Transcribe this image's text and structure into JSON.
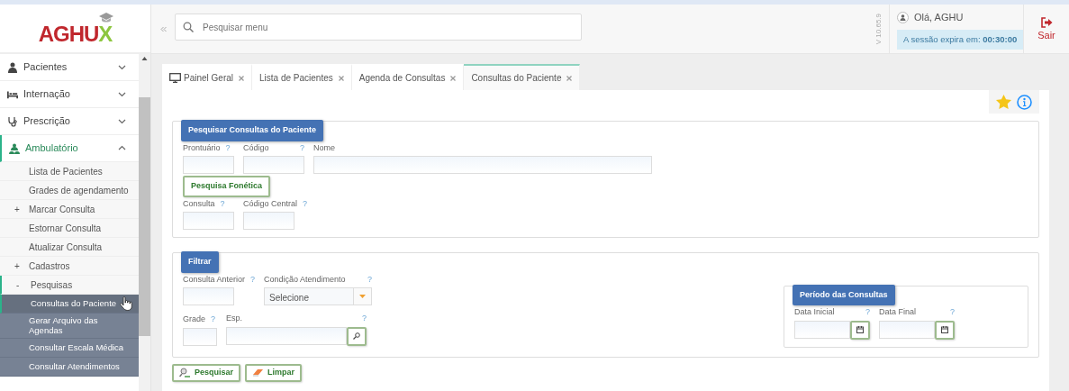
{
  "logo": {
    "main": "AGHU",
    "accent": "X"
  },
  "search": {
    "placeholder": "Pesquisar menu"
  },
  "version": "V 10.65.9",
  "user": {
    "greeting": "Olá, AGHU",
    "session": "A sessão expira em: **00:30:00**"
  },
  "logout": {
    "label": "Sair"
  },
  "sidebar": {
    "items": [
      {
        "label": "Pacientes",
        "expanded": false
      },
      {
        "label": "Internação",
        "expanded": false
      },
      {
        "label": "Prescrição",
        "expanded": false
      },
      {
        "label": "Ambulatório",
        "expanded": true,
        "children": [
          {
            "label": "Lista de Pacientes",
            "selected": false
          },
          {
            "label": "Grades de agendamento",
            "selected": false
          },
          {
            "label": "Marcar Consulta",
            "toggle": "+",
            "selected": false
          },
          {
            "label": "Estornar Consulta",
            "selected": false
          },
          {
            "label": "Atualizar Consulta",
            "selected": false
          },
          {
            "label": "Cadastros",
            "toggle": "+",
            "selected": false
          },
          {
            "label": "Pesquisas",
            "toggle": "-",
            "selected": false,
            "children": [
              {
                "label": "Consultas do Paciente",
                "selected": true
              },
              {
                "label": "Gerar Arquivo das Agendas",
                "selected": false
              },
              {
                "label": "Consultar Escala Médica",
                "selected": false
              },
              {
                "label": "Consultar Atendimentos",
                "selected": false
              }
            ]
          }
        ]
      }
    ]
  },
  "tabs": [
    {
      "label": "Painel Geral",
      "selected": false
    },
    {
      "label": "Lista de Pacientes",
      "selected": false
    },
    {
      "label": "Agenda de Consultas",
      "selected": false
    },
    {
      "label": "Consultas do Paciente",
      "selected": true
    }
  ],
  "search_form": {
    "legend": "Pesquisar Consultas do Paciente",
    "rows": [
      {
        "items": [
          {
            "kind": "text",
            "label": "Prontuário",
            "help": "?"
          },
          {
            "kind": "text",
            "label": "Código",
            "help": "?"
          },
          {
            "kind": "text",
            "label": "Nome"
          }
        ]
      },
      {
        "items": [
          {
            "kind": "button",
            "label": "Pesquisa Fonética"
          }
        ]
      },
      {
        "items": [
          {
            "kind": "text",
            "label": "Consulta",
            "help": "?"
          },
          {
            "kind": "text",
            "label": "Código Central",
            "help": "?"
          }
        ]
      }
    ]
  },
  "filter_form": {
    "legend": "Filtrar",
    "rows": [
      {
        "items": [
          {
            "kind": "text",
            "label": "Consulta Anterior",
            "help": "?"
          },
          {
            "kind": "select",
            "label": "Condição Atendimento",
            "help": "?",
            "value": "Selecione"
          }
        ]
      },
      {
        "items": [
          {
            "kind": "text",
            "label": "Grade",
            "help": "?"
          },
          {
            "kind": "lookup",
            "label": "Esp.",
            "help": "?"
          }
        ]
      }
    ],
    "period": {
      "legend": "Período das Consultas",
      "items": [
        {
          "kind": "date",
          "label": "Data Inicial",
          "help": "?"
        },
        {
          "kind": "date",
          "label": "Data Final",
          "help": "?"
        }
      ]
    }
  },
  "actions": [
    {
      "label": "Pesquisar"
    },
    {
      "label": "Limpar"
    }
  ]
}
